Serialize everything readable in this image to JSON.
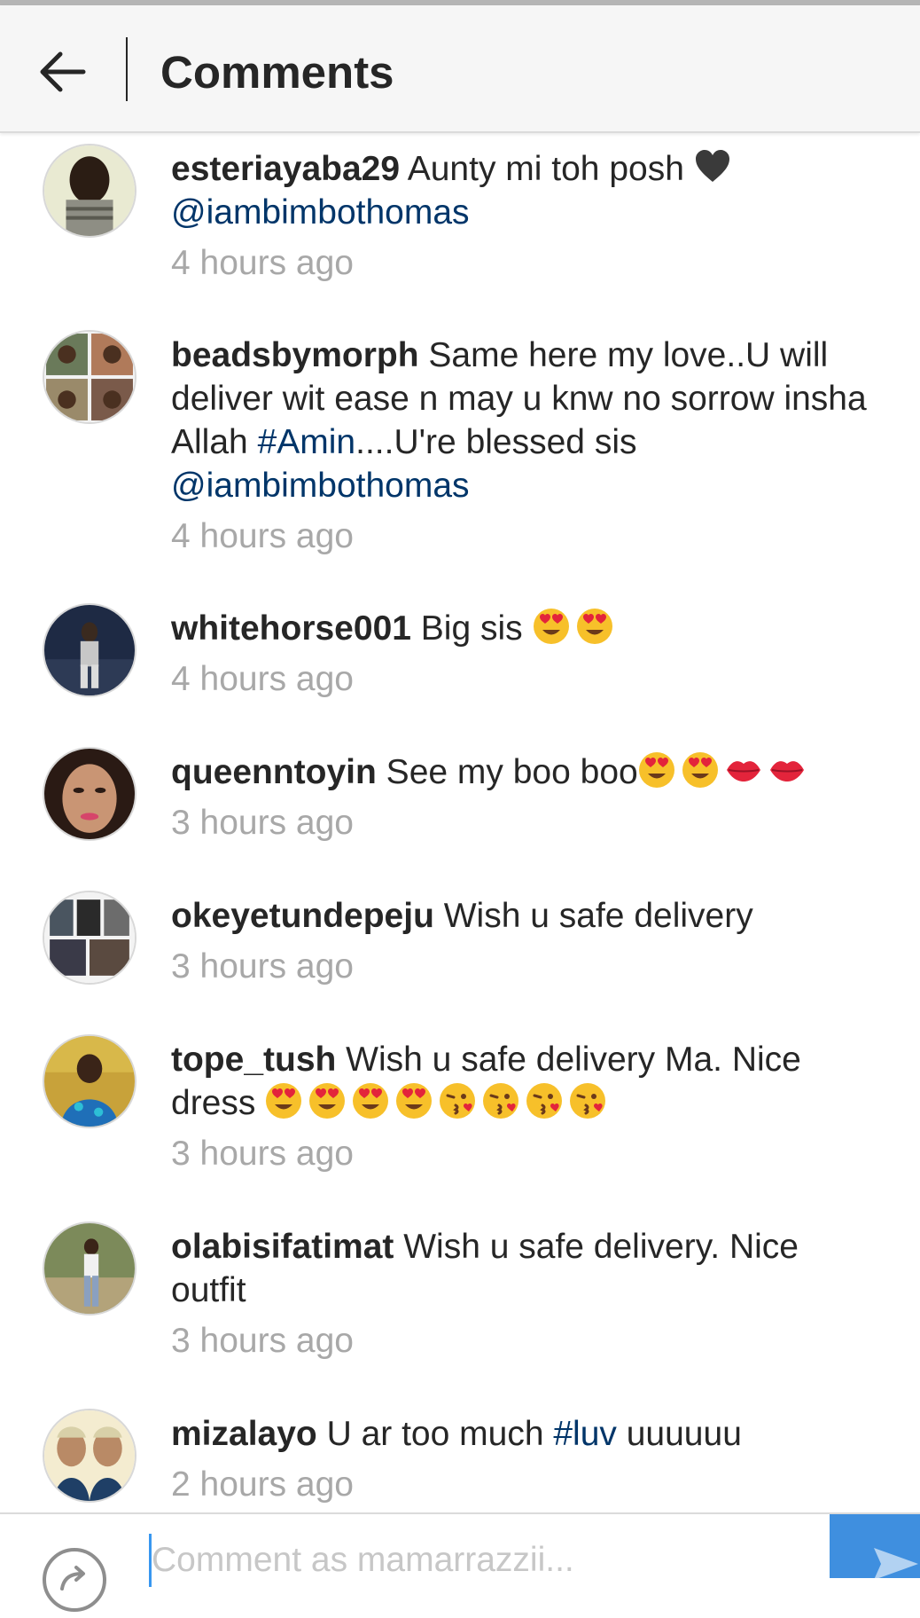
{
  "header": {
    "title": "Comments",
    "back_icon": "arrow-left-icon"
  },
  "comments": [
    {
      "username": "esteriayaba29",
      "parts": [
        {
          "text": " Aunty mi toh posh "
        }
      ],
      "emoji_after": [
        "black-heart"
      ],
      "tail": [
        {
          "text": "@iambimbothomas",
          "link": true
        }
      ],
      "time": "4 hours ago"
    },
    {
      "username": "beadsbymorph",
      "parts": [
        {
          "text": " Same here my love..U will deliver wit ease n may u knw no sorrow insha Allah "
        },
        {
          "text": "#Amin",
          "link": true
        },
        {
          "text": "....U're blessed sis "
        },
        {
          "text": "@iambimbothomas",
          "link": true
        }
      ],
      "time": "4 hours ago"
    },
    {
      "username": "whitehorse001",
      "parts": [
        {
          "text": " Big sis "
        }
      ],
      "emoji_after": [
        "heart-eyes",
        "heart-eyes"
      ],
      "time": "4 hours ago"
    },
    {
      "username": "queenntoyin",
      "parts": [
        {
          "text": " See my boo boo"
        }
      ],
      "emoji_after": [
        "heart-eyes",
        "heart-eyes",
        "kiss-lips",
        "kiss-lips"
      ],
      "time": "3 hours ago"
    },
    {
      "username": "okeyetundepeju",
      "parts": [
        {
          "text": " Wish u safe delivery"
        }
      ],
      "time": "3 hours ago"
    },
    {
      "username": "tope_tush",
      "parts": [
        {
          "text": " Wish u safe delivery Ma. Nice dress "
        }
      ],
      "emoji_after": [
        "heart-eyes",
        "heart-eyes",
        "heart-eyes",
        "heart-eyes",
        "kissing-heart",
        "kissing-heart",
        "kissing-heart",
        "kissing-heart"
      ],
      "time": "3 hours ago"
    },
    {
      "username": "olabisifatimat",
      "parts": [
        {
          "text": " Wish u safe delivery. Nice outfit"
        }
      ],
      "time": "3 hours ago"
    },
    {
      "username": "mizalayo",
      "parts": [
        {
          "text": " U ar too much "
        },
        {
          "text": "#luv",
          "link": true
        },
        {
          "text": " uuuuuu"
        }
      ],
      "time": "2 hours ago"
    }
  ],
  "footer": {
    "share_icon": "share-arrow-icon",
    "input_placeholder": "Comment as mamarrazzii...",
    "send_icon": "send-icon"
  },
  "colors": {
    "text": "#262626",
    "link": "#003569",
    "timestamp": "#a8a8a8",
    "header_bg": "#f6f6f6",
    "send_button": "#3f8fdf"
  }
}
